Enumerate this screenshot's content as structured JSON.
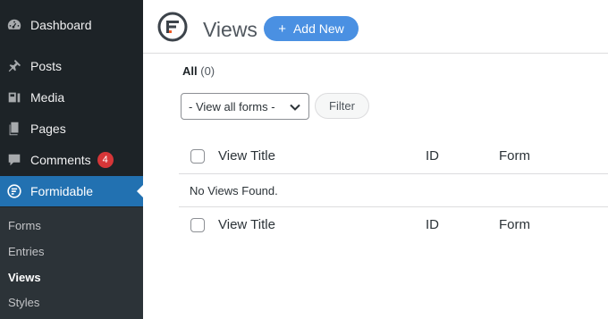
{
  "sidebar": {
    "items": [
      {
        "label": "Dashboard",
        "icon": "dashboard-icon"
      },
      {
        "label": "Posts",
        "icon": "pushpin-icon"
      },
      {
        "label": "Media",
        "icon": "media-icon"
      },
      {
        "label": "Pages",
        "icon": "pages-icon"
      },
      {
        "label": "Comments",
        "icon": "comment-icon",
        "badge": "4"
      },
      {
        "label": "Formidable",
        "icon": "formidable-icon",
        "active": true
      }
    ],
    "submenu": [
      {
        "label": "Forms"
      },
      {
        "label": "Entries"
      },
      {
        "label": "Views",
        "current": true
      },
      {
        "label": "Styles"
      }
    ]
  },
  "header": {
    "title": "Views",
    "add_new_label": "Add New"
  },
  "filters": {
    "all_label": "All",
    "all_count": "(0)",
    "select_value": "- View all forms -",
    "filter_button": "Filter"
  },
  "table": {
    "columns": [
      "View Title",
      "ID",
      "Form"
    ],
    "empty_message": "No Views Found."
  },
  "colors": {
    "sidebar_bg": "#1d2327",
    "submenu_bg": "#2c3338",
    "active_bg": "#2271b1",
    "button_blue": "#4a90e2",
    "badge_red": "#d63638"
  }
}
